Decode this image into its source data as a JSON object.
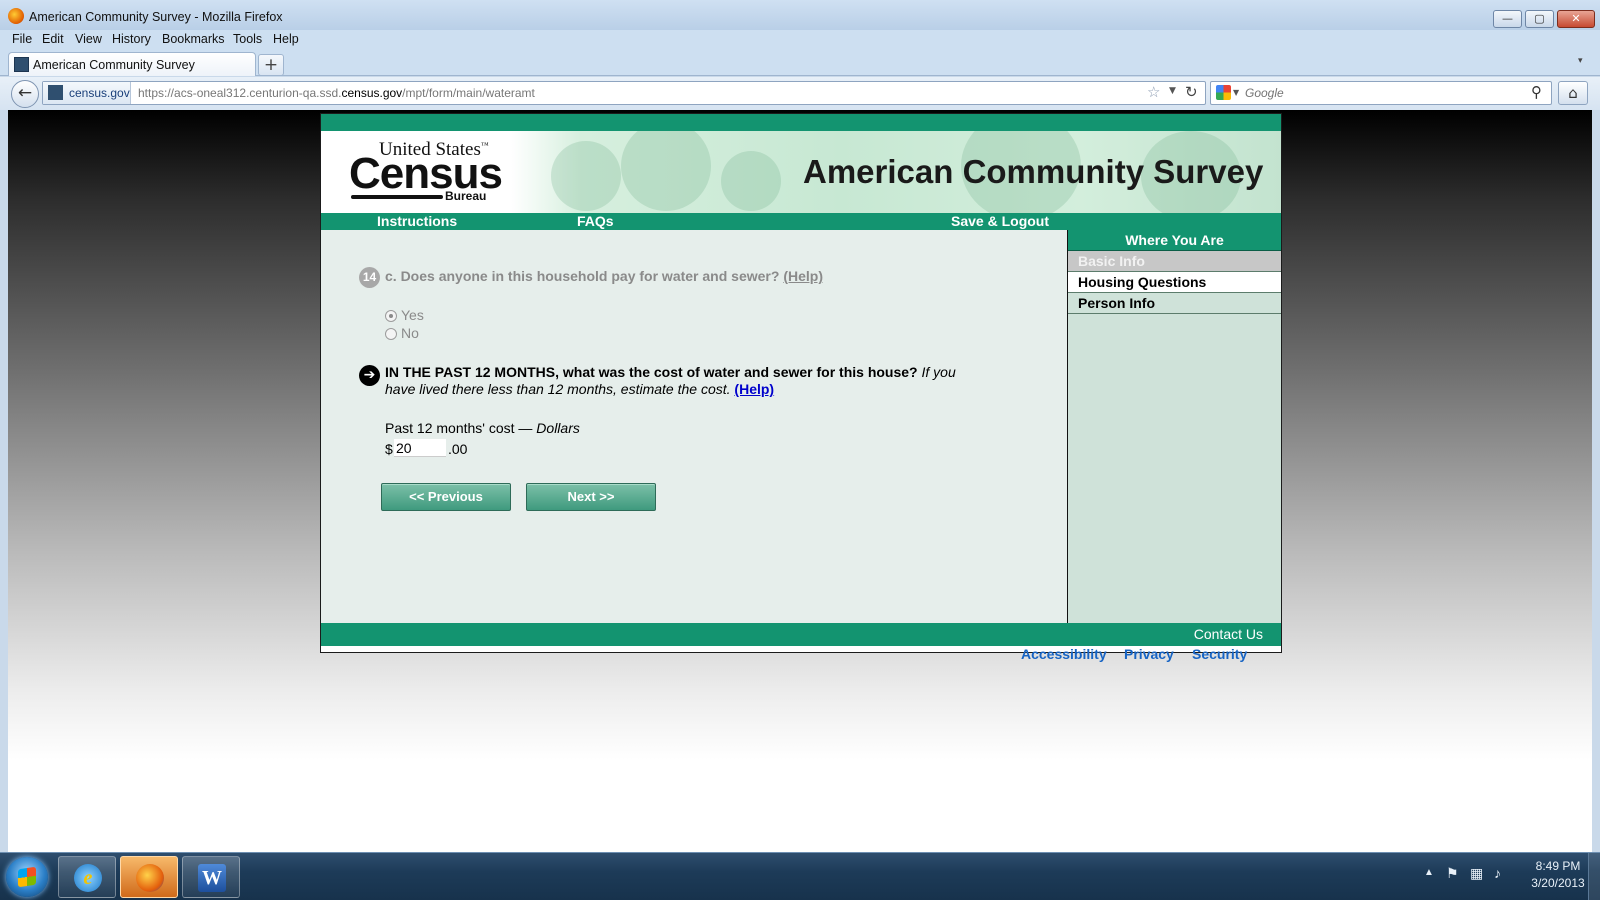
{
  "window": {
    "title": "American Community Survey - Mozilla Firefox",
    "controls": {
      "minimize": "—",
      "maximize": "▢",
      "close": "✕"
    }
  },
  "menu": [
    "File",
    "Edit",
    "View",
    "History",
    "Bookmarks",
    "Tools",
    "Help"
  ],
  "tab": {
    "title": "American Community Survey",
    "new_tab_label": "+",
    "list_arrow": "▾"
  },
  "navbar": {
    "identity_domain": "census.gov",
    "url_prefix": "https://acs-oneal312.centurion-qa.ssd.",
    "url_domain": "census.gov",
    "url_suffix": "/mpt/form/main/wateramt",
    "search_placeholder": "Google",
    "icons": {
      "back": "back-arrow-icon",
      "star": "star-icon",
      "reload": "reload-icon",
      "search": "magnifier-icon",
      "home": "home-icon"
    }
  },
  "site": {
    "logo": {
      "line1": "United States",
      "tm": "™",
      "line2": "Census",
      "line3": "Bureau"
    },
    "banner_title": "American Community Survey",
    "nav": {
      "instructions": "Instructions",
      "faqs": "FAQs",
      "save_logout": "Save & Logout"
    },
    "sidebar": {
      "heading": "Where You Are",
      "items": [
        {
          "label": "Basic Info",
          "state": "done"
        },
        {
          "label": "Housing Questions",
          "state": "current"
        },
        {
          "label": "Person Info",
          "state": "todo"
        }
      ]
    },
    "question1": {
      "number": "14",
      "text": "c. Does anyone in this household pay for water and sewer?",
      "help": "(Help)",
      "options": [
        {
          "label": "Yes",
          "selected": true
        },
        {
          "label": "No",
          "selected": false
        }
      ]
    },
    "question2": {
      "bold": "IN THE PAST 12 MONTHS, what was the cost of water and sewer for this house?",
      "italic": "If you have lived there less than 12 months, estimate the cost.",
      "help": "(Help)",
      "cost_label": "Past 12 months' cost — ",
      "cost_unit": "Dollars",
      "currency": "$",
      "amount": "20",
      "cents": ".00"
    },
    "buttons": {
      "previous": "<<   Previous",
      "next": "Next   >>"
    },
    "footer": {
      "contact": "Contact Us"
    },
    "links": {
      "accessibility": "Accessibility",
      "privacy": "Privacy",
      "security": "Security"
    }
  },
  "taskbar": {
    "apps": [
      "internet-explorer-icon",
      "firefox-icon",
      "word-icon"
    ],
    "word_letter": "W",
    "ie_letter": "e",
    "time": "8:49 PM",
    "date": "3/20/2013"
  }
}
